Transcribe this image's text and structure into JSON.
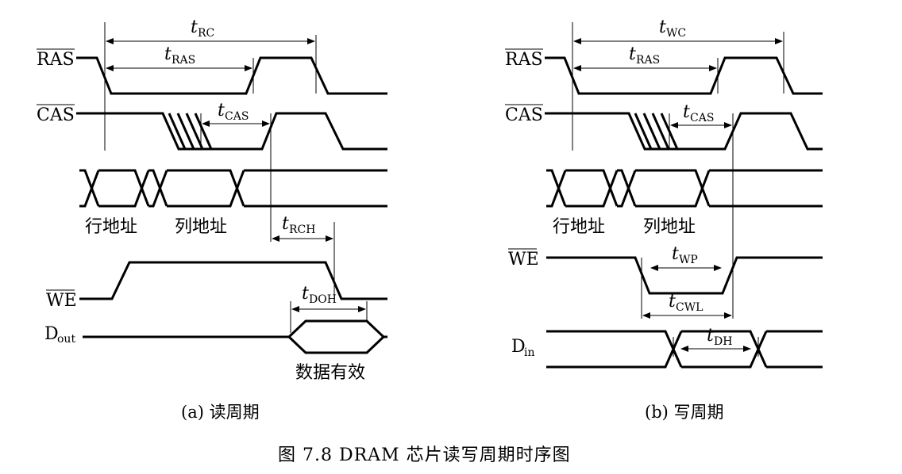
{
  "panel_a": {
    "caption": "(a) 读周期",
    "signals": {
      "ras": "RAS",
      "cas": "CAS",
      "we": "WE",
      "dout_main": "D",
      "dout_sub": "out"
    },
    "address_labels": {
      "row": "行地址",
      "col": "列地址"
    },
    "data_label": "数据有效",
    "timing": {
      "t_rc": {
        "t": "t",
        "sub": "RC"
      },
      "t_ras": {
        "t": "t",
        "sub": "RAS"
      },
      "t_cas": {
        "t": "t",
        "sub": "CAS"
      },
      "t_rch": {
        "t": "t",
        "sub": "RCH"
      },
      "t_doh": {
        "t": "t",
        "sub": "DOH"
      }
    }
  },
  "panel_b": {
    "caption": "(b) 写周期",
    "signals": {
      "ras": "RAS",
      "cas": "CAS",
      "we": "WE",
      "din_main": "D",
      "din_sub": "in"
    },
    "address_labels": {
      "row": "行地址",
      "col": "列地址"
    },
    "timing": {
      "t_wc": {
        "t": "t",
        "sub": "WC"
      },
      "t_ras": {
        "t": "t",
        "sub": "RAS"
      },
      "t_cas": {
        "t": "t",
        "sub": "CAS"
      },
      "t_wp": {
        "t": "t",
        "sub": "WP"
      },
      "t_cwl": {
        "t": "t",
        "sub": "CWL"
      },
      "t_dh": {
        "t": "t",
        "sub": "DH"
      }
    }
  },
  "figure_caption": "图 7.8   DRAM 芯片读写周期时序图"
}
